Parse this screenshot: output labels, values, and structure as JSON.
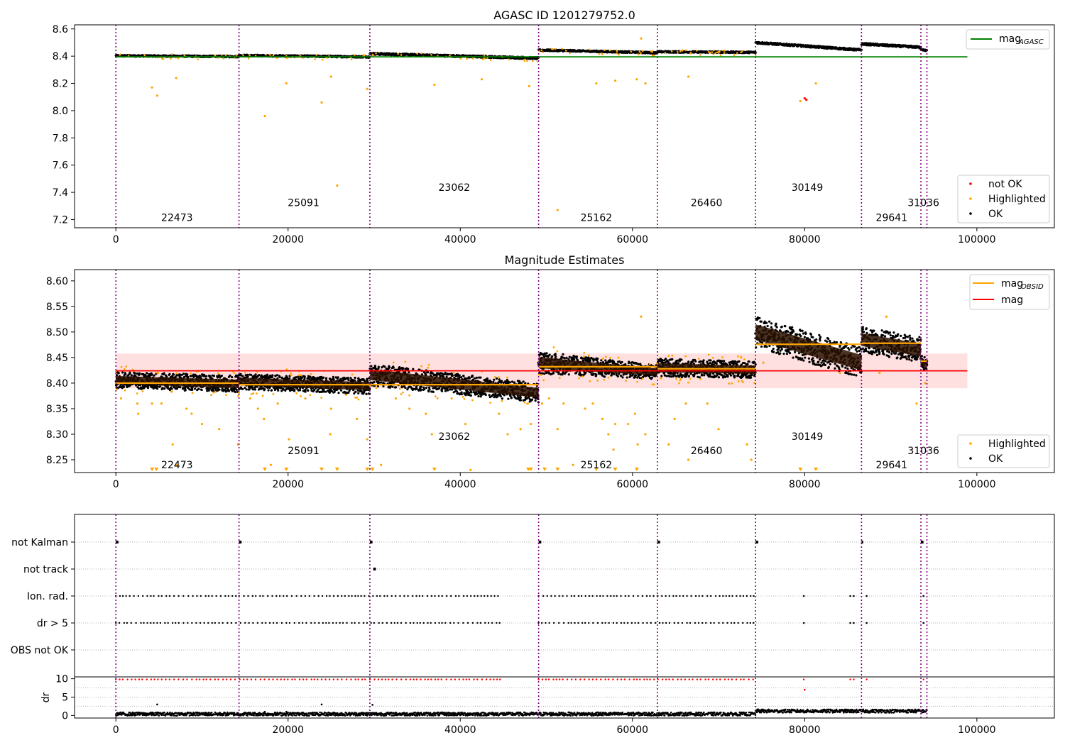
{
  "chart_data": [
    {
      "type": "scatter",
      "title": "AGASC ID 1201279752.0",
      "xlim": [
        -4800,
        109000
      ],
      "ylim": [
        7.14,
        8.63
      ],
      "xticks": [
        "0",
        "20000",
        "40000",
        "60000",
        "80000",
        "100000"
      ],
      "xtick_values": [
        0,
        20000,
        40000,
        60000,
        80000,
        100000
      ],
      "yticks": [
        "7.2",
        "7.4",
        "7.6",
        "7.8",
        "8.0",
        "8.2",
        "8.4",
        "8.6"
      ],
      "ytick_values": [
        7.2,
        7.4,
        7.6,
        7.8,
        8.0,
        8.2,
        8.4,
        8.6
      ],
      "reference_line": {
        "label": "mag_AGASC",
        "value": 8.395,
        "x_range": [
          0,
          98900
        ],
        "color": "#008000"
      },
      "legend_line": {
        "main": "mag",
        "sub": "AGASC"
      },
      "legend_scatter": [
        "not OK",
        "Highlighted",
        "OK"
      ],
      "legend_scatter_colors": [
        "#ff0000",
        "#ffa500",
        "#000000"
      ],
      "obsid_boundaries": [
        0,
        14300,
        29500,
        49100,
        62900,
        74300,
        86600,
        93500,
        94200
      ],
      "obsid_labels": [
        {
          "text": "22473",
          "x": 7100,
          "y": 7.19
        },
        {
          "text": "25091",
          "x": 21800,
          "y": 7.3
        },
        {
          "text": "23062",
          "x": 39300,
          "y": 7.41
        },
        {
          "text": "25162",
          "x": 55800,
          "y": 7.19
        },
        {
          "text": "26460",
          "x": 68600,
          "y": 7.3
        },
        {
          "text": "30149",
          "x": 80300,
          "y": 7.41
        },
        {
          "text": "29641",
          "x": 90100,
          "y": 7.19
        },
        {
          "text": "31036",
          "x": 93800,
          "y": 7.3
        }
      ],
      "segments": [
        {
          "x": [
            0,
            14300
          ],
          "mag": [
            8.403,
            8.397
          ],
          "spread": 0.012
        },
        {
          "x": [
            14300,
            29500
          ],
          "mag": [
            8.405,
            8.395
          ],
          "spread": 0.012
        },
        {
          "x": [
            29500,
            49100
          ],
          "mag": [
            8.418,
            8.385
          ],
          "spread": 0.015
        },
        {
          "x": [
            49100,
            62900
          ],
          "mag": [
            8.445,
            8.425
          ],
          "spread": 0.012
        },
        {
          "x": [
            62900,
            74300
          ],
          "mag": [
            8.432,
            8.428
          ],
          "spread": 0.012
        },
        {
          "x": [
            74300,
            86600
          ],
          "mag": [
            8.5,
            8.445
          ],
          "spread": 0.015
        },
        {
          "x": [
            86600,
            93500
          ],
          "mag": [
            8.49,
            8.465
          ],
          "spread": 0.015
        },
        {
          "x": [
            93500,
            94200
          ],
          "mag": [
            8.45,
            8.44
          ],
          "spread": 0.01
        }
      ],
      "highlighted_outliers": [
        [
          4200,
          8.17
        ],
        [
          4800,
          8.11
        ],
        [
          7000,
          8.24
        ],
        [
          17300,
          7.96
        ],
        [
          19800,
          8.2
        ],
        [
          23900,
          8.06
        ],
        [
          25000,
          8.25
        ],
        [
          25700,
          7.45
        ],
        [
          29200,
          8.16
        ],
        [
          37000,
          8.19
        ],
        [
          42500,
          8.23
        ],
        [
          48000,
          8.18
        ],
        [
          51300,
          7.27
        ],
        [
          55800,
          8.2
        ],
        [
          58000,
          8.22
        ],
        [
          60500,
          8.23
        ],
        [
          61000,
          8.53
        ],
        [
          61500,
          8.2
        ],
        [
          66500,
          8.25
        ],
        [
          79500,
          8.07
        ],
        [
          81300,
          8.2
        ]
      ],
      "not_ok_points": [
        [
          80000,
          8.09
        ],
        [
          80200,
          8.08
        ]
      ]
    },
    {
      "type": "scatter",
      "title": "Magnitude Estimates",
      "xlim": [
        -4800,
        109000
      ],
      "ylim": [
        8.225,
        8.622
      ],
      "xticks": [
        "0",
        "20000",
        "40000",
        "60000",
        "80000",
        "100000"
      ],
      "xtick_values": [
        0,
        20000,
        40000,
        60000,
        80000,
        100000
      ],
      "yticks": [
        "8.25",
        "8.30",
        "8.35",
        "8.40",
        "8.45",
        "8.50",
        "8.55",
        "8.60"
      ],
      "ytick_values": [
        8.25,
        8.3,
        8.35,
        8.4,
        8.45,
        8.5,
        8.55,
        8.6
      ],
      "mag": {
        "value": 8.424,
        "band": [
          8.39,
          8.458
        ],
        "x_range": [
          0,
          98900
        ],
        "color": "#ff0000"
      },
      "mag_obsid": [
        {
          "x": [
            0,
            14300
          ],
          "value": 8.4
        },
        {
          "x": [
            14300,
            29500
          ],
          "value": 8.397
        },
        {
          "x": [
            29500,
            49100
          ],
          "value": 8.397
        },
        {
          "x": [
            49100,
            62900
          ],
          "value": 8.432
        },
        {
          "x": [
            62900,
            74300
          ],
          "value": 8.428
        },
        {
          "x": [
            74300,
            86600
          ],
          "value": 8.476
        },
        {
          "x": [
            86600,
            93500
          ],
          "value": 8.478
        },
        {
          "x": [
            93500,
            94200
          ],
          "value": 8.443
        }
      ],
      "legend_lines": [
        {
          "main": "mag",
          "sub": "OBSID",
          "color": "#ffa500"
        },
        {
          "main": "mag",
          "sub": "",
          "color": "#ff0000"
        }
      ],
      "legend_scatter": [
        "Highlighted",
        "OK"
      ],
      "legend_scatter_colors": [
        "#ffa500",
        "#000000"
      ],
      "obsid_boundaries": [
        0,
        14300,
        29500,
        49100,
        62900,
        74300,
        86600,
        93500,
        94200
      ],
      "obsid_labels": [
        {
          "text": "22473",
          "x": 7100,
          "y": 8.233
        },
        {
          "text": "25091",
          "x": 21800,
          "y": 8.261
        },
        {
          "text": "23062",
          "x": 39300,
          "y": 8.289
        },
        {
          "text": "25162",
          "x": 55800,
          "y": 8.233
        },
        {
          "text": "26460",
          "x": 68600,
          "y": 8.261
        },
        {
          "text": "30149",
          "x": 80300,
          "y": 8.289
        },
        {
          "text": "29641",
          "x": 90100,
          "y": 8.233
        },
        {
          "text": "31036",
          "x": 93800,
          "y": 8.261
        }
      ],
      "segments": [
        {
          "x": [
            0,
            14300
          ],
          "top": [
            8.422,
            8.415
          ],
          "bottom": [
            8.39,
            8.382
          ]
        },
        {
          "x": [
            14300,
            29500
          ],
          "top": [
            8.418,
            8.41
          ],
          "bottom": [
            8.388,
            8.378
          ]
        },
        {
          "x": [
            29500,
            49100
          ],
          "top": [
            8.438,
            8.4
          ],
          "bottom": [
            8.395,
            8.362
          ]
        },
        {
          "x": [
            49100,
            62900
          ],
          "top": [
            8.462,
            8.435
          ],
          "bottom": [
            8.418,
            8.408
          ]
        },
        {
          "x": [
            62900,
            74300
          ],
          "top": [
            8.448,
            8.442
          ],
          "bottom": [
            8.412,
            8.41
          ]
        },
        {
          "x": [
            74300,
            86600
          ],
          "top": [
            8.53,
            8.47
          ],
          "bottom": [
            8.47,
            8.41
          ]
        },
        {
          "x": [
            86600,
            93500
          ],
          "top": [
            8.51,
            8.49
          ],
          "bottom": [
            8.46,
            8.44
          ]
        },
        {
          "x": [
            93500,
            94200
          ],
          "top": [
            8.455,
            8.45
          ],
          "bottom": [
            8.43,
            8.42
          ]
        }
      ],
      "highlighted_outliers": [
        [
          600,
          8.37
        ],
        [
          2500,
          8.36
        ],
        [
          2600,
          8.34
        ],
        [
          4200,
          8.36
        ],
        [
          5300,
          8.36
        ],
        [
          6600,
          8.28
        ],
        [
          7000,
          8.24
        ],
        [
          8200,
          8.35
        ],
        [
          8800,
          8.34
        ],
        [
          10000,
          8.32
        ],
        [
          12000,
          8.31
        ],
        [
          14200,
          8.28
        ],
        [
          15600,
          8.37
        ],
        [
          16500,
          8.35
        ],
        [
          17200,
          8.33
        ],
        [
          18000,
          8.24
        ],
        [
          18800,
          8.36
        ],
        [
          20100,
          8.29
        ],
        [
          22000,
          8.37
        ],
        [
          24900,
          8.3
        ],
        [
          25000,
          8.35
        ],
        [
          28000,
          8.33
        ],
        [
          29200,
          8.29
        ],
        [
          30800,
          8.24
        ],
        [
          32500,
          8.37
        ],
        [
          34100,
          8.35
        ],
        [
          36000,
          8.34
        ],
        [
          36700,
          8.3
        ],
        [
          39000,
          8.37
        ],
        [
          40600,
          8.32
        ],
        [
          41200,
          8.23
        ],
        [
          44500,
          8.34
        ],
        [
          45500,
          8.3
        ],
        [
          47000,
          8.31
        ],
        [
          48200,
          8.32
        ],
        [
          49500,
          8.36
        ],
        [
          50300,
          8.37
        ],
        [
          51300,
          8.31
        ],
        [
          52000,
          8.36
        ],
        [
          53100,
          8.24
        ],
        [
          54500,
          8.35
        ],
        [
          55400,
          8.36
        ],
        [
          56500,
          8.33
        ],
        [
          57200,
          8.3
        ],
        [
          57800,
          8.27
        ],
        [
          58000,
          8.32
        ],
        [
          59500,
          8.32
        ],
        [
          60300,
          8.34
        ],
        [
          60600,
          8.28
        ],
        [
          61000,
          8.53
        ],
        [
          61500,
          8.3
        ],
        [
          64200,
          8.28
        ],
        [
          64900,
          8.33
        ],
        [
          66200,
          8.36
        ],
        [
          66500,
          8.25
        ],
        [
          68700,
          8.36
        ],
        [
          70000,
          8.31
        ],
        [
          73300,
          8.28
        ],
        [
          73800,
          8.25
        ],
        [
          75200,
          8.44
        ],
        [
          84100,
          8.42
        ],
        [
          88700,
          8.42
        ],
        [
          89500,
          8.53
        ],
        [
          93000,
          8.36
        ],
        [
          94000,
          8.4
        ]
      ],
      "clipped_markers": [
        4200,
        4700,
        17300,
        19800,
        23900,
        25700,
        29200,
        29800,
        37000,
        47900,
        48200,
        49800,
        51300,
        55800,
        58000,
        60500,
        79500,
        81300
      ]
    },
    {
      "type": "scatter",
      "xlim": [
        -4800,
        109000
      ],
      "xticks": [
        "0",
        "20000",
        "40000",
        "60000",
        "80000",
        "100000"
      ],
      "xtick_values": [
        0,
        20000,
        40000,
        60000,
        80000,
        100000
      ],
      "flag_labels": [
        "not Kalman",
        "not track",
        "Ion. rad.",
        "dr > 5",
        "OBS not OK"
      ],
      "flag_x_ranges": {
        "not Kalman": [
          [
            0,
            300
          ],
          [
            14300,
            14600
          ],
          [
            29500,
            29800
          ],
          [
            49100,
            49400
          ],
          [
            62900,
            63200
          ],
          [
            74300,
            74600
          ],
          [
            86600,
            86800
          ],
          [
            93500,
            93800
          ]
        ],
        "not track": [
          [
            29900,
            30200
          ]
        ],
        "Ion. rad.": [
          [
            0,
            44700
          ],
          [
            49100,
            74300
          ]
        ],
        "dr > 5": [
          [
            0,
            44700
          ],
          [
            49100,
            74300
          ]
        ],
        "OBS not OK": []
      },
      "flag_extra_points": [
        [
          79900,
          0
        ],
        [
          85300,
          0
        ],
        [
          85700,
          0
        ],
        [
          87200,
          0
        ],
        [
          93800,
          0
        ]
      ],
      "dr": {
        "ylabel": "dr",
        "yticks": [
          "0",
          "5",
          "10"
        ],
        "ytick_values": [
          0,
          5,
          10
        ],
        "ylim": [
          -0.7,
          10.5
        ],
        "gridline_values": [
          2.5,
          5,
          7.5
        ],
        "clip_value": 9.8,
        "outliers": [
          [
            4800,
            3.0
          ],
          [
            80000,
            7.0
          ],
          [
            23900,
            3.0
          ],
          [
            29800,
            2.9
          ],
          [
            17300,
            1.0
          ],
          [
            19800,
            1.0
          ]
        ]
      },
      "obsid_boundaries": [
        0,
        14300,
        29500,
        49100,
        62900,
        74300,
        86600,
        93500,
        94200
      ]
    }
  ]
}
